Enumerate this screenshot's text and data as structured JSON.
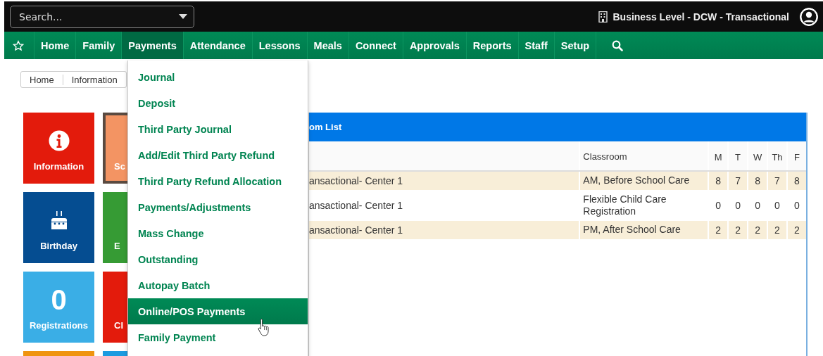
{
  "search": {
    "placeholder": "Search..."
  },
  "business": {
    "label": "Business Level - DCW - Transactional"
  },
  "nav": {
    "items": [
      {
        "kind": "star",
        "selected": false
      },
      {
        "kind": "link",
        "label": "Home",
        "selected": false
      },
      {
        "kind": "link",
        "label": "Family",
        "selected": false
      },
      {
        "kind": "link",
        "label": "Payments",
        "selected": true
      },
      {
        "kind": "link",
        "label": "Attendance",
        "selected": false
      },
      {
        "kind": "link",
        "label": "Lessons",
        "selected": false
      },
      {
        "kind": "link",
        "label": "Meals",
        "selected": false
      },
      {
        "kind": "link",
        "label": "Connect",
        "selected": false
      },
      {
        "kind": "link",
        "label": "Approvals",
        "selected": false
      },
      {
        "kind": "link",
        "label": "Reports",
        "selected": false
      },
      {
        "kind": "link",
        "label": "Staff",
        "selected": false
      },
      {
        "kind": "link",
        "label": "Setup",
        "selected": false
      },
      {
        "kind": "search",
        "selected": false
      }
    ]
  },
  "payments_menu": {
    "items": [
      {
        "label": "Journal",
        "selected": false
      },
      {
        "label": "Deposit",
        "selected": false
      },
      {
        "label": "Third Party Journal",
        "selected": false
      },
      {
        "label": "Add/Edit Third Party Refund",
        "selected": false
      },
      {
        "label": "Third Party Refund Allocation",
        "selected": false
      },
      {
        "label": "Payments/Adjustments",
        "selected": false
      },
      {
        "label": "Mass Change",
        "selected": false
      },
      {
        "label": "Outstanding",
        "selected": false
      },
      {
        "label": "Autopay Batch",
        "selected": false
      },
      {
        "label": "Online/POS Payments",
        "selected": true
      },
      {
        "label": "Family Payment",
        "selected": false
      }
    ]
  },
  "breadcrumb": [
    "Home",
    "Information"
  ],
  "tiles": [
    {
      "kind": "info",
      "label": "Information",
      "color": "#e31b0c",
      "selected": false
    },
    {
      "kind": "plain",
      "label": "Sc",
      "color": "#f39463",
      "selected": true
    },
    {
      "kind": "cake",
      "label": "Birthday",
      "color": "#054d91",
      "selected": false
    },
    {
      "kind": "plain",
      "label": "E",
      "color": "#369b34",
      "selected": false
    },
    {
      "kind": "count",
      "count": "0",
      "label": "Registrations",
      "color": "#3aaee6",
      "selected": false
    },
    {
      "kind": "plain",
      "label": "Cl",
      "color": "#e31b0c",
      "selected": false
    },
    {
      "kind": "plain",
      "color": "#ef9410",
      "selected": false
    },
    {
      "kind": "plain",
      "color": "#1c9be0",
      "selected": false
    }
  ],
  "panel": {
    "title": "om List",
    "columns": [
      "",
      "Classroom",
      "M",
      "T",
      "W",
      "Th",
      "F"
    ],
    "rows": [
      {
        "cells": [
          "ansactional- Center 1",
          "AM, Before School Care",
          "8",
          "7",
          "8",
          "7",
          "8"
        ]
      },
      {
        "cells": [
          "ansactional- Center 1",
          "Flexible Child Care Registration",
          "0",
          "0",
          "0",
          "0",
          "0"
        ]
      },
      {
        "cells": [
          "ansactional- Center 1",
          "PM, After School Care",
          "2",
          "2",
          "2",
          "2",
          "2"
        ]
      }
    ]
  }
}
